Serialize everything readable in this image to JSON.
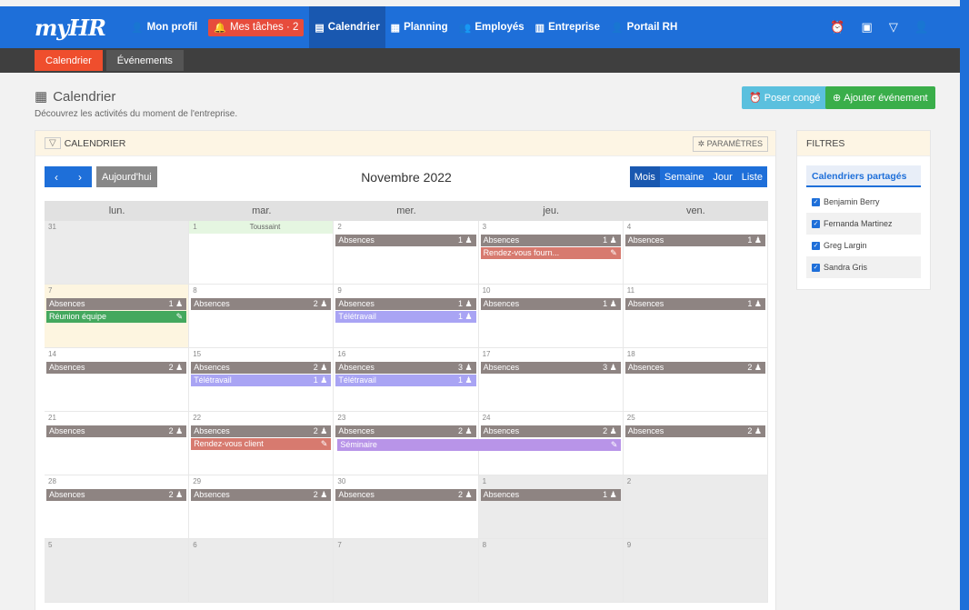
{
  "app": {
    "logo": "myHR"
  },
  "nav": [
    {
      "icon": "👤",
      "label": "Mon profil"
    },
    {
      "icon": "🔔",
      "label": "Mes tâches · 2"
    },
    {
      "icon": "▤",
      "label": "Calendrier"
    },
    {
      "icon": "▦",
      "label": "Planning"
    },
    {
      "icon": "👥",
      "label": "Employés"
    },
    {
      "icon": "▥",
      "label": "Entreprise"
    },
    {
      "icon": "👤",
      "label": "Portail RH"
    }
  ],
  "top_icons": [
    "alarm-icon",
    "clipboard-icon",
    "filter-icon",
    "user-icon"
  ],
  "subnav": [
    "Calendrier",
    "Événements"
  ],
  "page": {
    "title": "Calendrier",
    "subtitle": "Découvrez les activités du moment de l'entreprise."
  },
  "buttons": {
    "leave": "Poser congé",
    "add": "Ajouter événement"
  },
  "calendar": {
    "header": "CALENDRIER",
    "params": "PARAMÈTRES",
    "today": "Aujourd'hui",
    "month": "Novembre 2022",
    "views": [
      "Mois",
      "Semaine",
      "Jour",
      "Liste"
    ],
    "days": [
      "lun.",
      "mar.",
      "mer.",
      "jeu.",
      "ven."
    ],
    "holiday": "Toussaint",
    "weeks": [
      [
        {
          "d": "31",
          "gray": true,
          "ev": []
        },
        {
          "d": "1",
          "green": true,
          "ev": []
        },
        {
          "d": "2",
          "ev": [
            [
              "abs",
              "Absences",
              "1"
            ]
          ]
        },
        {
          "d": "3",
          "ev": [
            [
              "abs",
              "Absences",
              "1"
            ],
            [
              "rdv",
              "Rendez-vous fourn...",
              ""
            ]
          ]
        },
        {
          "d": "4",
          "ev": [
            [
              "abs",
              "Absences",
              "1"
            ]
          ]
        }
      ],
      [
        {
          "d": "7",
          "today": true,
          "ev": [
            [
              "abs",
              "Absences",
              "1"
            ],
            [
              "meet",
              "Réunion équipe",
              ""
            ]
          ]
        },
        {
          "d": "8",
          "ev": [
            [
              "abs",
              "Absences",
              "2"
            ]
          ]
        },
        {
          "d": "9",
          "ev": [
            [
              "abs",
              "Absences",
              "1"
            ],
            [
              "tele",
              "Télétravail",
              "1"
            ]
          ]
        },
        {
          "d": "10",
          "ev": [
            [
              "abs",
              "Absences",
              "1"
            ]
          ]
        },
        {
          "d": "11",
          "ev": [
            [
              "abs",
              "Absences",
              "1"
            ]
          ]
        }
      ],
      [
        {
          "d": "14",
          "ev": [
            [
              "abs",
              "Absences",
              "2"
            ]
          ]
        },
        {
          "d": "15",
          "ev": [
            [
              "abs",
              "Absences",
              "2"
            ],
            [
              "tele",
              "Télétravail",
              "1"
            ]
          ]
        },
        {
          "d": "16",
          "ev": [
            [
              "abs",
              "Absences",
              "3"
            ],
            [
              "tele",
              "Télétravail",
              "1"
            ]
          ]
        },
        {
          "d": "17",
          "ev": [
            [
              "abs",
              "Absences",
              "3"
            ]
          ]
        },
        {
          "d": "18",
          "ev": [
            [
              "abs",
              "Absences",
              "2"
            ]
          ]
        }
      ],
      [
        {
          "d": "21",
          "ev": [
            [
              "abs",
              "Absences",
              "2"
            ]
          ]
        },
        {
          "d": "22",
          "ev": [
            [
              "abs",
              "Absences",
              "2"
            ],
            [
              "rdv",
              "Rendez-vous client",
              ""
            ]
          ]
        },
        {
          "d": "23",
          "ev": [
            [
              "abs",
              "Absences",
              "2"
            ]
          ],
          "sem": "Séminaire"
        },
        {
          "d": "24",
          "ev": [
            [
              "abs",
              "Absences",
              "2"
            ]
          ]
        },
        {
          "d": "25",
          "ev": [
            [
              "abs",
              "Absences",
              "2"
            ]
          ]
        }
      ],
      [
        {
          "d": "28",
          "ev": [
            [
              "abs",
              "Absences",
              "2"
            ]
          ]
        },
        {
          "d": "29",
          "ev": [
            [
              "abs",
              "Absences",
              "2"
            ]
          ]
        },
        {
          "d": "30",
          "ev": [
            [
              "abs",
              "Absences",
              "2"
            ]
          ]
        },
        {
          "d": "1",
          "gray": true,
          "ev": [
            [
              "abs",
              "Absences",
              "1"
            ]
          ]
        },
        {
          "d": "2",
          "gray": true,
          "ev": []
        }
      ],
      [
        {
          "d": "5",
          "gray": true,
          "ev": []
        },
        {
          "d": "6",
          "gray": true,
          "ev": []
        },
        {
          "d": "7",
          "gray": true,
          "ev": []
        },
        {
          "d": "8",
          "gray": true,
          "ev": []
        },
        {
          "d": "9",
          "gray": true,
          "ev": []
        }
      ]
    ]
  },
  "filters": {
    "title": "FILTRES",
    "shared": "Calendriers partagés",
    "people": [
      "Benjamin Berry",
      "Fernanda Martinez",
      "Greg Largin",
      "Sandra Gris"
    ]
  },
  "colors": {
    "primary": "#1e6fd9",
    "active_tab": "#ef4e2d",
    "absence": "#8e8482",
    "meeting": "#44a85e",
    "telework": "#a9a4f4",
    "appointment": "#d77a6f",
    "seminar": "#b894e8"
  }
}
